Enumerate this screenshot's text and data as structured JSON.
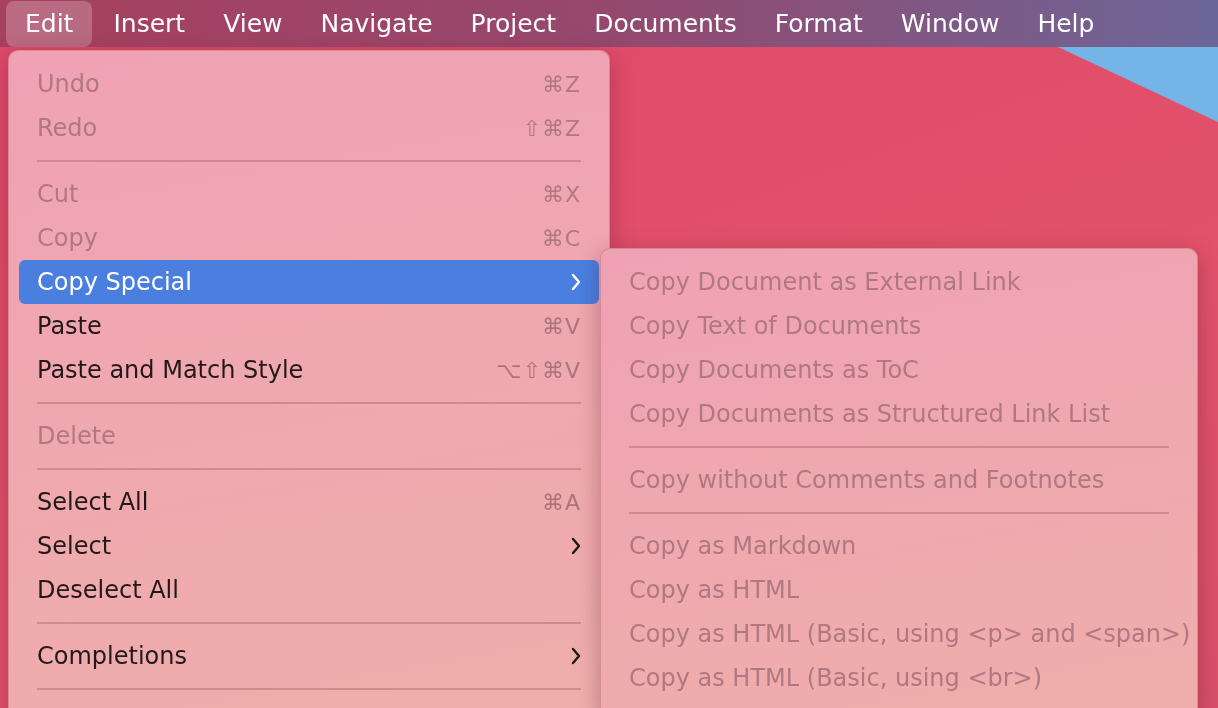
{
  "menu_bar": [
    {
      "label": "Edit",
      "selected": true
    },
    {
      "label": "Insert",
      "selected": false
    },
    {
      "label": "View",
      "selected": false
    },
    {
      "label": "Navigate",
      "selected": false
    },
    {
      "label": "Project",
      "selected": false
    },
    {
      "label": "Documents",
      "selected": false
    },
    {
      "label": "Format",
      "selected": false
    },
    {
      "label": "Window",
      "selected": false
    },
    {
      "label": "Help",
      "selected": false
    }
  ],
  "edit_menu": {
    "items": [
      {
        "kind": "item",
        "label": "Undo",
        "shortcut": "⌘Z",
        "disabled": true,
        "selected": false,
        "submenu": false
      },
      {
        "kind": "item",
        "label": "Redo",
        "shortcut": "⇧⌘Z",
        "disabled": true,
        "selected": false,
        "submenu": false
      },
      {
        "kind": "separator"
      },
      {
        "kind": "item",
        "label": "Cut",
        "shortcut": "⌘X",
        "disabled": true,
        "selected": false,
        "submenu": false
      },
      {
        "kind": "item",
        "label": "Copy",
        "shortcut": "⌘C",
        "disabled": true,
        "selected": false,
        "submenu": false
      },
      {
        "kind": "item",
        "label": "Copy Special",
        "disabled": false,
        "selected": true,
        "submenu": true
      },
      {
        "kind": "item",
        "label": "Paste",
        "shortcut": "⌘V",
        "disabled": false,
        "selected": false,
        "submenu": false
      },
      {
        "kind": "item",
        "label": "Paste and Match Style",
        "shortcut": "⌥⇧⌘V",
        "disabled": false,
        "selected": false,
        "submenu": false
      },
      {
        "kind": "separator"
      },
      {
        "kind": "item",
        "label": "Delete",
        "disabled": true,
        "selected": false,
        "submenu": false
      },
      {
        "kind": "separator"
      },
      {
        "kind": "item",
        "label": "Select All",
        "shortcut": "⌘A",
        "disabled": false,
        "selected": false,
        "submenu": false
      },
      {
        "kind": "item",
        "label": "Select",
        "disabled": false,
        "selected": false,
        "submenu": true
      },
      {
        "kind": "item",
        "label": "Deselect All",
        "disabled": false,
        "selected": false,
        "submenu": false
      },
      {
        "kind": "separator"
      },
      {
        "kind": "item",
        "label": "Completions",
        "disabled": false,
        "selected": false,
        "submenu": true
      },
      {
        "kind": "separator"
      }
    ]
  },
  "copy_special_submenu": {
    "items": [
      {
        "kind": "item",
        "label": "Copy Document as External Link",
        "disabled": true
      },
      {
        "kind": "item",
        "label": "Copy Text of Documents",
        "disabled": true
      },
      {
        "kind": "item",
        "label": "Copy Documents as ToC",
        "disabled": true
      },
      {
        "kind": "item",
        "label": "Copy Documents as Structured Link List",
        "disabled": true
      },
      {
        "kind": "separator"
      },
      {
        "kind": "item",
        "label": "Copy without Comments and Footnotes",
        "disabled": true
      },
      {
        "kind": "separator"
      },
      {
        "kind": "item",
        "label": "Copy as Markdown",
        "disabled": true
      },
      {
        "kind": "item",
        "label": "Copy as HTML",
        "disabled": true
      },
      {
        "kind": "item",
        "label": "Copy as HTML (Basic, using <p> and <span>)",
        "disabled": true
      },
      {
        "kind": "item",
        "label": "Copy as HTML (Basic, using <br>)",
        "disabled": true
      }
    ]
  }
}
